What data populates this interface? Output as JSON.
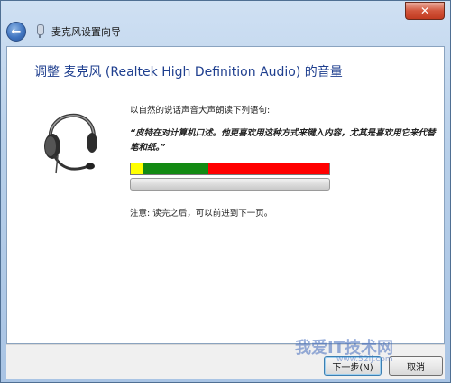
{
  "window": {
    "title": "麦克风设置向导",
    "close_label": "✕"
  },
  "page": {
    "heading": "调整 麦克风 (Realtek High Definition Audio) 的音量",
    "instruction": "以自然的说话声音大声朗读下列语句:",
    "quote": "“皮特在对计算机口述。他更喜欢用这种方式来键入内容，尤其是喜欢用它来代替笔和纸。”",
    "note": "注意: 读完之后，可以前进到下一页。"
  },
  "meter": {
    "levels": {
      "yellow": 0.06,
      "green": 0.33,
      "red": 0.61
    },
    "colors": {
      "yellow": "#ffff00",
      "green": "#138a13",
      "red": "#ff0000"
    }
  },
  "progress": {
    "value": 0
  },
  "buttons": {
    "next": "下一步(N)",
    "cancel": "取消"
  },
  "watermark": {
    "text": "我爱IT技术网",
    "url": "www.52ij.com"
  }
}
